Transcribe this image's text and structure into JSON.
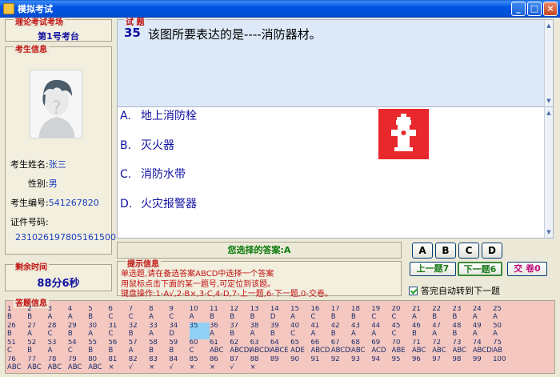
{
  "window": {
    "title": "模拟考试",
    "btn_min": "_",
    "btn_max": "□",
    "btn_close": "×"
  },
  "exam_site": {
    "legend": "理论考试考场",
    "value": "第1号考台"
  },
  "examinee": {
    "legend": "考生信息",
    "name_label": "考生姓名:",
    "name": "张三",
    "gender_label": "性别:",
    "gender": "男",
    "id_label": "考生编号:",
    "id": "541267820",
    "cert_label": "证件号码:",
    "cert": "231026197805161500"
  },
  "timer": {
    "legend": "剩余时间",
    "value": "88分6秒"
  },
  "question": {
    "legend": "试 题",
    "number": "35",
    "text": "该图所要表达的是----消防器材。",
    "options": [
      {
        "key": "A.",
        "text": "地上消防栓"
      },
      {
        "key": "B.",
        "text": "灭火器"
      },
      {
        "key": "C.",
        "text": "消防水带"
      },
      {
        "key": "D.",
        "text": "火灾报警器"
      }
    ],
    "scroll_up": "▲",
    "scroll_down": "▼"
  },
  "chosen_answer": "您选择的答案:A",
  "hints": {
    "legend": "提示信息",
    "lines": [
      "单选题,请在备选答案ABCD中选择一个答案",
      "用鼠标点击下面的某一题号,可定位到该题。",
      "键盘操作:1-A√,2-B×,3-C,4-D,7-上一题,6-下一题,0-交卷。"
    ]
  },
  "answer_buttons": [
    "A",
    "B",
    "C",
    "D"
  ],
  "nav": {
    "prev": "上一题7",
    "next": "下一题6",
    "submit": "交 卷0",
    "auto_next": "答完自动转到下一题"
  },
  "grid": {
    "legend": "答题信息",
    "current": 35,
    "cells": [
      {
        "n": "1",
        "a": "B"
      },
      {
        "n": "2",
        "a": "B"
      },
      {
        "n": "3",
        "a": "A"
      },
      {
        "n": "4",
        "a": "A"
      },
      {
        "n": "5",
        "a": "B"
      },
      {
        "n": "6",
        "a": "C"
      },
      {
        "n": "7",
        "a": "C"
      },
      {
        "n": "8",
        "a": "A"
      },
      {
        "n": "9",
        "a": "C"
      },
      {
        "n": "10",
        "a": "A"
      },
      {
        "n": "11",
        "a": "B"
      },
      {
        "n": "12",
        "a": "B"
      },
      {
        "n": "13",
        "a": "B"
      },
      {
        "n": "14",
        "a": "D"
      },
      {
        "n": "15",
        "a": "A"
      },
      {
        "n": "16",
        "a": "C"
      },
      {
        "n": "17",
        "a": "B"
      },
      {
        "n": "18",
        "a": "B"
      },
      {
        "n": "19",
        "a": "C"
      },
      {
        "n": "20",
        "a": "C"
      },
      {
        "n": "21",
        "a": "A"
      },
      {
        "n": "22",
        "a": "B"
      },
      {
        "n": "23",
        "a": "B"
      },
      {
        "n": "24",
        "a": "A"
      },
      {
        "n": "25",
        "a": "A"
      },
      {
        "n": "",
        "a": ""
      },
      {
        "n": "",
        "a": ""
      },
      {
        "n": "26",
        "a": "B"
      },
      {
        "n": "27",
        "a": "A"
      },
      {
        "n": "28",
        "a": "C"
      },
      {
        "n": "29",
        "a": "B"
      },
      {
        "n": "30",
        "a": "A"
      },
      {
        "n": "31",
        "a": "C"
      },
      {
        "n": "32",
        "a": "B"
      },
      {
        "n": "33",
        "a": "A"
      },
      {
        "n": "34",
        "a": "D"
      },
      {
        "n": "35",
        "a": ""
      },
      {
        "n": "36",
        "a": "A"
      },
      {
        "n": "37",
        "a": "B"
      },
      {
        "n": "38",
        "a": "A"
      },
      {
        "n": "39",
        "a": "B"
      },
      {
        "n": "40",
        "a": "C"
      },
      {
        "n": "41",
        "a": "A"
      },
      {
        "n": "42",
        "a": "B"
      },
      {
        "n": "43",
        "a": "A"
      },
      {
        "n": "44",
        "a": "A"
      },
      {
        "n": "45",
        "a": "C"
      },
      {
        "n": "46",
        "a": "B"
      },
      {
        "n": "47",
        "a": "A"
      },
      {
        "n": "48",
        "a": "B"
      },
      {
        "n": "49",
        "a": "A"
      },
      {
        "n": "50",
        "a": "A"
      },
      {
        "n": "",
        "a": ""
      },
      {
        "n": "",
        "a": ""
      },
      {
        "n": "51",
        "a": "C"
      },
      {
        "n": "52",
        "a": "B"
      },
      {
        "n": "53",
        "a": "A"
      },
      {
        "n": "54",
        "a": "C"
      },
      {
        "n": "55",
        "a": "B"
      },
      {
        "n": "56",
        "a": "B"
      },
      {
        "n": "57",
        "a": "A"
      },
      {
        "n": "58",
        "a": "B"
      },
      {
        "n": "59",
        "a": "B"
      },
      {
        "n": "60",
        "a": "C"
      },
      {
        "n": "61",
        "a": "ABC"
      },
      {
        "n": "62",
        "a": "ABCDE"
      },
      {
        "n": "63",
        "a": "ABCDE"
      },
      {
        "n": "64",
        "a": "ABCE"
      },
      {
        "n": "65",
        "a": "ADE"
      },
      {
        "n": "66",
        "a": "ABCD"
      },
      {
        "n": "67",
        "a": "ABCDE"
      },
      {
        "n": "68",
        "a": "ABC"
      },
      {
        "n": "69",
        "a": "ACD"
      },
      {
        "n": "70",
        "a": "ABE"
      },
      {
        "n": "71",
        "a": "ABC"
      },
      {
        "n": "72",
        "a": "ABC"
      },
      {
        "n": "73",
        "a": "ABC"
      },
      {
        "n": "74",
        "a": "ABCDE"
      },
      {
        "n": "75",
        "a": "AB"
      },
      {
        "n": "",
        "a": ""
      },
      {
        "n": "",
        "a": ""
      },
      {
        "n": "76",
        "a": "ABC"
      },
      {
        "n": "77",
        "a": "ABC"
      },
      {
        "n": "78",
        "a": "ABC"
      },
      {
        "n": "79",
        "a": "ABC"
      },
      {
        "n": "80",
        "a": "ABC"
      },
      {
        "n": "81",
        "a": "×"
      },
      {
        "n": "82",
        "a": "√"
      },
      {
        "n": "83",
        "a": "×"
      },
      {
        "n": "84",
        "a": "√"
      },
      {
        "n": "85",
        "a": "×"
      },
      {
        "n": "86",
        "a": "×"
      },
      {
        "n": "87",
        "a": "√"
      },
      {
        "n": "88",
        "a": "×"
      },
      {
        "n": "89",
        "a": ""
      },
      {
        "n": "90",
        "a": ""
      },
      {
        "n": "91",
        "a": ""
      },
      {
        "n": "92",
        "a": ""
      },
      {
        "n": "93",
        "a": ""
      },
      {
        "n": "94",
        "a": ""
      },
      {
        "n": "95",
        "a": ""
      },
      {
        "n": "96",
        "a": ""
      },
      {
        "n": "97",
        "a": ""
      },
      {
        "n": "98",
        "a": ""
      },
      {
        "n": "99",
        "a": ""
      },
      {
        "n": "100",
        "a": ""
      },
      {
        "n": "",
        "a": ""
      },
      {
        "n": "",
        "a": ""
      }
    ]
  }
}
